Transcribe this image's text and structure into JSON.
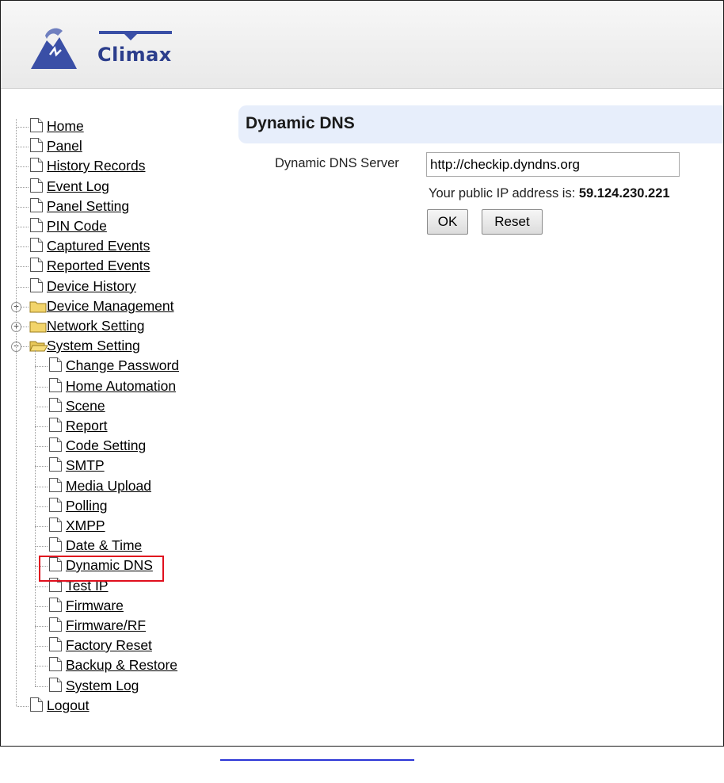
{
  "brand": {
    "name": "Climax",
    "color": "#2c3e8c"
  },
  "sidebar": {
    "items": [
      {
        "label": "Home",
        "type": "page"
      },
      {
        "label": "Panel",
        "type": "page"
      },
      {
        "label": "History Records",
        "type": "page"
      },
      {
        "label": "Event Log",
        "type": "page"
      },
      {
        "label": "Panel Setting",
        "type": "page"
      },
      {
        "label": "PIN Code",
        "type": "page"
      },
      {
        "label": "Captured Events",
        "type": "page"
      },
      {
        "label": "Reported Events",
        "type": "page"
      },
      {
        "label": "Device History",
        "type": "page"
      },
      {
        "label": "Device Management",
        "type": "folder",
        "expanded": false,
        "expander": "+"
      },
      {
        "label": "Network Setting",
        "type": "folder",
        "expanded": false,
        "expander": "+"
      },
      {
        "label": "System Setting",
        "type": "folder",
        "expanded": true,
        "expander": "−"
      }
    ],
    "system_children": [
      "Change Password",
      "Home Automation",
      "Scene",
      "Report",
      "Code Setting",
      "SMTP",
      "Media Upload",
      "Polling",
      "XMPP",
      "Date & Time",
      "Dynamic DNS",
      "Test IP",
      "Firmware",
      "Firmware/RF",
      "Factory Reset",
      "Backup & Restore",
      "System Log"
    ],
    "logout": "Logout",
    "highlighted_item": "Dynamic DNS",
    "highlight_color": "#e0101e"
  },
  "content": {
    "title": "Dynamic DNS",
    "server_label": "Dynamic DNS Server",
    "server_value": "http://checkip.dyndns.org",
    "ip_prefix": "Your public IP address is:",
    "ip_value": "59.124.230.221",
    "ok_label": "OK",
    "reset_label": "Reset",
    "title_bg": "#e7eefb"
  }
}
